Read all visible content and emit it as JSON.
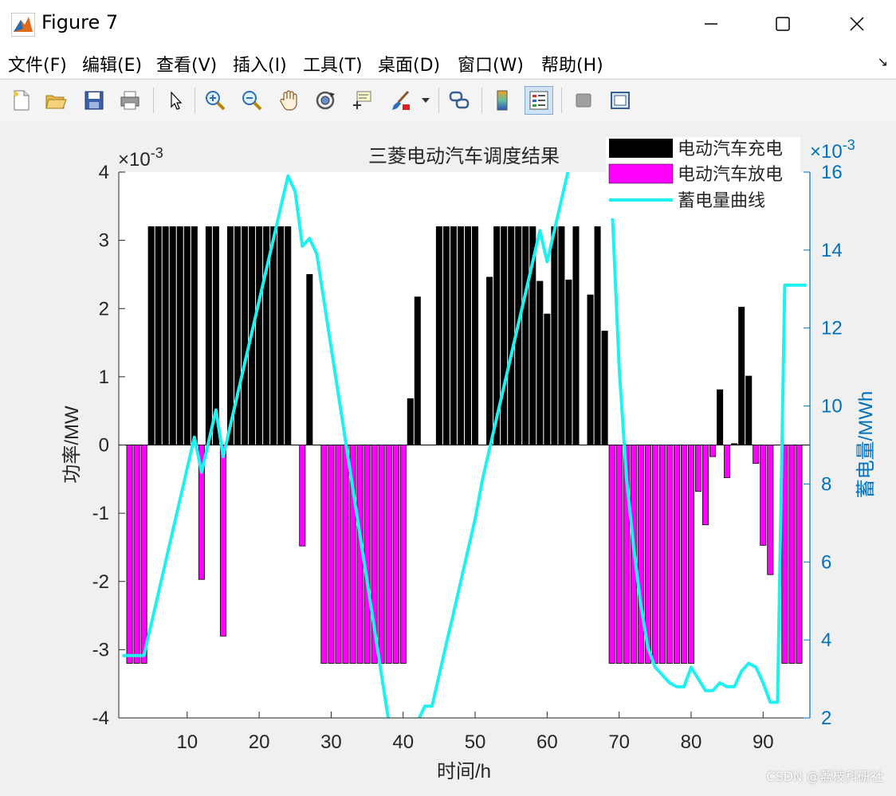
{
  "window": {
    "title": "Figure 7",
    "controls": {
      "minimize": "minimize",
      "maximize": "maximize",
      "close": "close"
    }
  },
  "menubar": {
    "items": [
      {
        "label": "文件(F)"
      },
      {
        "label": "编辑(E)"
      },
      {
        "label": "查看(V)"
      },
      {
        "label": "插入(I)"
      },
      {
        "label": "工具(T)"
      },
      {
        "label": "桌面(D)"
      },
      {
        "label": "窗口(W)"
      },
      {
        "label": "帮助(H)"
      }
    ]
  },
  "toolbar": {
    "icons": [
      "new-figure-icon",
      "open-file-icon",
      "save-icon",
      "print-icon",
      "select-arrow-icon",
      "zoom-in-icon",
      "zoom-out-icon",
      "pan-hand-icon",
      "rotate-3d-icon",
      "data-cursor-icon",
      "brush-icon",
      "link-plot-icon",
      "colorbar-icon",
      "legend-icon",
      "hide-plot-tools-icon",
      "show-plot-tools-icon"
    ]
  },
  "watermark": "CSDN @荔枝科研社",
  "colors": {
    "charge": "#000000",
    "discharge": "#ff00ff",
    "storage": "#1ff0f0",
    "right_axis": "#0072bd"
  },
  "chart_data": {
    "type": "bar",
    "title": "三菱电动汽车调度结果",
    "xlabel": "时间/h",
    "ylabel": "功率/MW",
    "ylabel_right": "蓄电量/MWh",
    "exponent_left": "×10^{-3}",
    "exponent_right": "×10^{-3}",
    "xlim": [
      1,
      96
    ],
    "ylim": [
      -4,
      4
    ],
    "ylim_right": [
      2,
      16
    ],
    "xticks": [
      10,
      20,
      30,
      40,
      50,
      60,
      70,
      80,
      90
    ],
    "yticks": [
      -4,
      -3,
      -2,
      -1,
      0,
      1,
      2,
      3,
      4
    ],
    "yticks_right": [
      2,
      4,
      6,
      8,
      10,
      12,
      14,
      16
    ],
    "grid": false,
    "legend_position": "top-right",
    "series": [
      {
        "name": "电动汽车充电",
        "type": "bar",
        "x": [
          5,
          6,
          7,
          8,
          9,
          10,
          11,
          13,
          14,
          16,
          17,
          18,
          19,
          20,
          21,
          22,
          23,
          24,
          27,
          41,
          42,
          45,
          46,
          47,
          48,
          49,
          50,
          52,
          53,
          54,
          55,
          56,
          57,
          58,
          59,
          60,
          61,
          62,
          63,
          64,
          66,
          67,
          68,
          84,
          86,
          87,
          88
        ],
        "values": [
          3.2,
          3.2,
          3.2,
          3.2,
          3.2,
          3.2,
          3.2,
          3.2,
          3.2,
          3.2,
          3.2,
          3.2,
          3.2,
          3.2,
          3.2,
          3.2,
          3.2,
          3.2,
          2.5,
          0.68,
          2.17,
          3.2,
          3.2,
          3.2,
          3.2,
          3.2,
          3.2,
          2.46,
          3.2,
          3.2,
          3.2,
          3.2,
          3.2,
          3.2,
          2.4,
          1.92,
          3.2,
          3.2,
          2.42,
          3.2,
          2.2,
          3.2,
          1.67,
          0.81,
          0.02,
          2.02,
          1.01
        ]
      },
      {
        "name": "电动汽车放电",
        "type": "bar",
        "x": [
          2,
          3,
          4,
          12,
          15,
          26,
          29,
          30,
          31,
          32,
          33,
          34,
          35,
          36,
          37,
          38,
          39,
          40,
          69,
          70,
          71,
          72,
          73,
          74,
          75,
          76,
          77,
          78,
          79,
          80,
          81,
          82,
          83,
          85,
          89,
          90,
          91,
          93,
          94,
          95
        ],
        "values": [
          -3.2,
          -3.2,
          -3.2,
          -1.97,
          -2.8,
          -1.48,
          -3.2,
          -3.2,
          -3.2,
          -3.2,
          -3.2,
          -3.2,
          -3.2,
          -3.2,
          -3.2,
          -3.2,
          -3.2,
          -3.2,
          -3.2,
          -3.2,
          -3.2,
          -3.2,
          -3.2,
          -3.2,
          -3.2,
          -3.2,
          -3.2,
          -3.2,
          -3.2,
          -3.2,
          -0.68,
          -1.17,
          -0.17,
          -0.48,
          -0.27,
          -1.47,
          -1.9,
          -3.2,
          -3.2,
          -3.2
        ]
      },
      {
        "name": "蓄电量曲线",
        "type": "line",
        "axis": "right",
        "x": [
          1,
          2,
          3,
          4,
          5,
          6,
          7,
          8,
          9,
          10,
          11,
          12,
          13,
          14,
          15,
          16,
          17,
          18,
          19,
          20,
          21,
          22,
          23,
          24,
          25,
          26,
          27,
          28,
          29,
          30,
          31,
          32,
          33,
          34,
          35,
          36,
          37,
          38,
          39,
          40,
          41,
          42,
          43,
          44,
          45,
          46,
          47,
          48,
          49,
          50,
          51,
          52,
          53,
          54,
          55,
          56,
          57,
          58,
          59,
          60,
          61,
          62,
          63,
          64,
          65,
          66,
          67,
          68,
          69,
          70,
          71,
          72,
          73,
          74,
          75,
          76,
          77,
          78,
          79,
          80,
          81,
          82,
          83,
          84,
          85,
          86,
          87,
          88,
          89,
          90,
          91,
          92,
          93,
          94,
          95,
          96
        ],
        "values": [
          3.6,
          3.6,
          3.6,
          3.6,
          4.4,
          5.2,
          6.0,
          6.8,
          7.6,
          8.4,
          9.2,
          8.3,
          9.1,
          9.9,
          8.7,
          9.5,
          10.3,
          11.1,
          11.9,
          12.7,
          13.5,
          14.3,
          15.1,
          15.9,
          15.5,
          14.1,
          14.3,
          13.9,
          12.7,
          11.5,
          10.3,
          9.1,
          7.9,
          6.7,
          5.5,
          4.3,
          3.1,
          1.9,
          0.7,
          -0.5,
          0.3,
          1.9,
          2.3,
          2.3,
          3.1,
          3.9,
          4.7,
          5.5,
          6.3,
          7.1,
          8.1,
          8.9,
          9.7,
          10.5,
          11.3,
          12.1,
          12.9,
          13.7,
          14.5,
          13.7,
          14.5,
          15.3,
          16.1,
          16.9,
          17.7,
          18.5,
          19.3,
          19.6,
          15.2,
          11.0,
          8.2,
          6.4,
          4.9,
          3.8,
          3.3,
          3.1,
          2.9,
          2.8,
          2.8,
          3.3,
          3.0,
          2.7,
          2.7,
          2.9,
          2.8,
          2.8,
          3.2,
          3.4,
          3.3,
          2.9,
          2.4,
          2.4,
          13.1,
          13.1,
          13.1,
          13.1
        ]
      }
    ]
  }
}
